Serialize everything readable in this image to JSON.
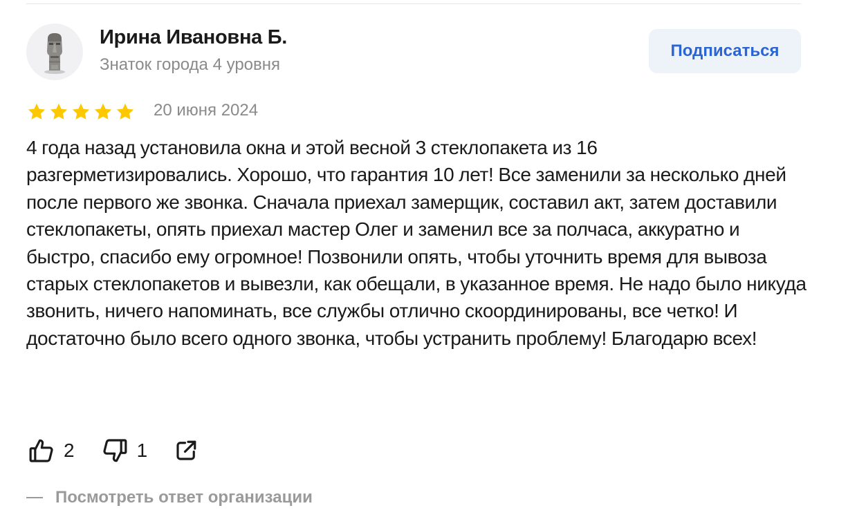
{
  "review": {
    "author": {
      "name": "Ирина Ивановна Б.",
      "level": "Знаток города 4 уровня",
      "avatar_icon": "moai-statue-icon"
    },
    "subscribe_label": "Подписаться",
    "rating": 5,
    "rating_max": 5,
    "date": "20 июня 2024",
    "text": "4 года назад установила окна и этой весной 3 стеклопакета из 16 разгерметизировались. Хорошо, что гарантия 10 лет! Все заменили за несколько дней после первого же звонка. Сначала приехал замерщик, составил акт, затем доставили стеклопакеты, опять приехал мастер Олег и заменил все за полчаса, аккуратно и быстро, спасибо ему огромное! Позвонили опять, чтобы уточнить время для вывоза старых стеклопакетов и вывезли, как обещали, в указанное время. Не надо было никуда звонить, ничего напоминать, все службы отлично скоординированы, все четко! И достаточно было всего одного звонка, чтобы устранить проблему! Благодарю всех!",
    "likes": "2",
    "dislikes": "1",
    "org_answer_label": "Посмотреть ответ организации"
  },
  "colors": {
    "star": "#fdc800",
    "accent": "#2a65d4",
    "button_bg": "#eef2f9",
    "muted_text": "#8a8a8a"
  }
}
